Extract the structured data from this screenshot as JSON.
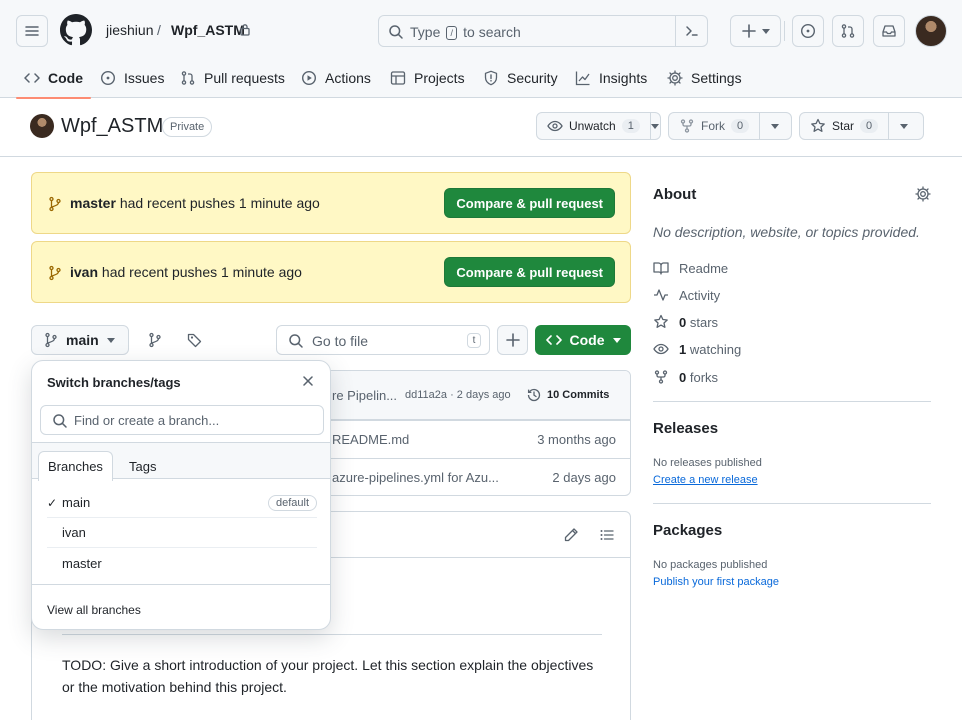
{
  "header": {
    "owner": "jieshiun",
    "separator": "/",
    "repo": "Wpf_ASTM",
    "search_placeholder_pre": "Type",
    "search_slash": "/",
    "search_placeholder_post": "to search"
  },
  "tabs": [
    {
      "label": "Code",
      "icon": "code-icon"
    },
    {
      "label": "Issues",
      "icon": "issue-opened-icon"
    },
    {
      "label": "Pull requests",
      "icon": "git-pull-request-icon"
    },
    {
      "label": "Actions",
      "icon": "play-icon"
    },
    {
      "label": "Projects",
      "icon": "table-icon"
    },
    {
      "label": "Security",
      "icon": "shield-icon"
    },
    {
      "label": "Insights",
      "icon": "graph-icon"
    },
    {
      "label": "Settings",
      "icon": "gear-icon"
    }
  ],
  "repo_header": {
    "name": "Wpf_ASTM",
    "visibility": "Private",
    "watch_label": "Unwatch",
    "watch_count": "1",
    "fork_label": "Fork",
    "fork_count": "0",
    "star_label": "Star",
    "star_count": "0"
  },
  "banners": [
    {
      "branch": "master",
      "text": "had recent pushes 1 minute ago",
      "button": "Compare & pull request"
    },
    {
      "branch": "ivan",
      "text": "had recent pushes 1 minute ago",
      "button": "Compare & pull request"
    }
  ],
  "file_nav": {
    "branch": "main",
    "goto_placeholder": "Go to file",
    "goto_key": "t",
    "code_label": "Code"
  },
  "latest_commit": {
    "message": "re Pipelin...",
    "sha_time": "dd11a2a · 2 days ago",
    "commits": "10 Commits"
  },
  "files": [
    {
      "message": "README.md",
      "date": "3 months ago"
    },
    {
      "message": "azure-pipelines.yml for Azu...",
      "date": "2 days ago"
    }
  ],
  "readme": {
    "text": "TODO: Give a short introduction of your project. Let this section explain the objectives or the motivation behind this project."
  },
  "about": {
    "title": "About",
    "description": "No description, website, or topics provided.",
    "readme": "Readme",
    "activity": "Activity",
    "stars_count": "0",
    "stars_label": "stars",
    "watching_count": "1",
    "watching_label": "watching",
    "forks_count": "0",
    "forks_label": "forks"
  },
  "releases": {
    "title": "Releases",
    "empty": "No releases published",
    "link": "Create a new release"
  },
  "packages": {
    "title": "Packages",
    "empty": "No packages published",
    "link": "Publish your first package"
  },
  "branch_dropdown": {
    "title": "Switch branches/tags",
    "search_placeholder": "Find or create a branch...",
    "tab_branches": "Branches",
    "tab_tags": "Tags",
    "items": [
      {
        "name": "main",
        "checked": "✓",
        "badge": "default"
      },
      {
        "name": "ivan",
        "checked": "",
        "badge": ""
      },
      {
        "name": "master",
        "checked": "",
        "badge": ""
      }
    ],
    "footer": "View all branches"
  },
  "colors": {
    "primary_green": "#1f883d",
    "banner_bg": "#fff8c5",
    "active_tab_underline": "#fd8c73",
    "link": "#0969da"
  }
}
